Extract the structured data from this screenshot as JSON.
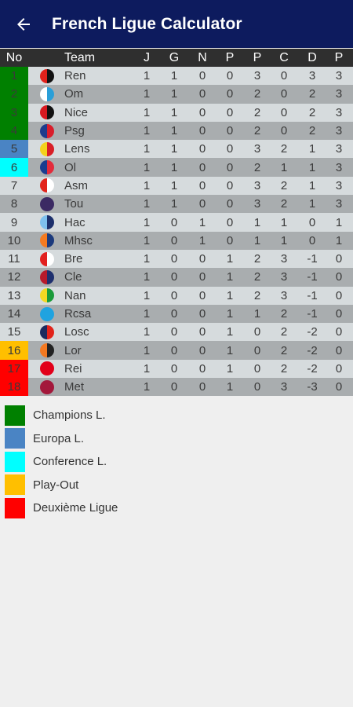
{
  "header": {
    "title": "French Ligue Calculator",
    "back_icon": "arrow-left-icon",
    "background": "#0d1b5e"
  },
  "table": {
    "columns": [
      "No",
      "Team",
      "J",
      "G",
      "N",
      "P",
      "P",
      "C",
      "D",
      "P"
    ],
    "rows": [
      {
        "no": "1",
        "team": "Ren",
        "j": "1",
        "g": "1",
        "n": "0",
        "l": "0",
        "gf": "3",
        "ga": "0",
        "d": "3",
        "pts": "3",
        "zone": "#008000",
        "logo": [
          "#e0211b",
          "#111111"
        ]
      },
      {
        "no": "2",
        "team": "Om",
        "j": "1",
        "g": "1",
        "n": "0",
        "l": "0",
        "gf": "2",
        "ga": "0",
        "d": "2",
        "pts": "3",
        "zone": "#008000",
        "logo": [
          "#ffffff",
          "#2a9fd8"
        ]
      },
      {
        "no": "3",
        "team": "Nice",
        "j": "1",
        "g": "1",
        "n": "0",
        "l": "0",
        "gf": "2",
        "ga": "0",
        "d": "2",
        "pts": "3",
        "zone": "#008000",
        "logo": [
          "#d71920",
          "#111111"
        ]
      },
      {
        "no": "4",
        "team": "Psg",
        "j": "1",
        "g": "1",
        "n": "0",
        "l": "0",
        "gf": "2",
        "ga": "0",
        "d": "2",
        "pts": "3",
        "zone": "#008000",
        "logo": [
          "#1e3c8c",
          "#d91e2b"
        ]
      },
      {
        "no": "5",
        "team": "Lens",
        "j": "1",
        "g": "1",
        "n": "0",
        "l": "0",
        "gf": "3",
        "ga": "2",
        "d": "1",
        "pts": "3",
        "zone": "#4a84c4",
        "logo": [
          "#f4d11b",
          "#d81f27"
        ]
      },
      {
        "no": "6",
        "team": "Ol",
        "j": "1",
        "g": "1",
        "n": "0",
        "l": "0",
        "gf": "2",
        "ga": "1",
        "d": "1",
        "pts": "3",
        "zone": "#00ffff",
        "logo": [
          "#1b3d8f",
          "#e32b3b"
        ]
      },
      {
        "no": "7",
        "team": "Asm",
        "j": "1",
        "g": "1",
        "n": "0",
        "l": "0",
        "gf": "3",
        "ga": "2",
        "d": "1",
        "pts": "3",
        "zone": "",
        "logo": [
          "#e2231a",
          "#ffffff"
        ]
      },
      {
        "no": "8",
        "team": "Tou",
        "j": "1",
        "g": "1",
        "n": "0",
        "l": "0",
        "gf": "3",
        "ga": "2",
        "d": "1",
        "pts": "3",
        "zone": "",
        "logo": [
          "#3b2a63",
          "#3b2a63"
        ]
      },
      {
        "no": "9",
        "team": "Hac",
        "j": "1",
        "g": "0",
        "n": "1",
        "l": "0",
        "gf": "1",
        "ga": "1",
        "d": "0",
        "pts": "1",
        "zone": "",
        "logo": [
          "#7ec0ee",
          "#1c2f6b"
        ]
      },
      {
        "no": "10",
        "team": "Mhsc",
        "j": "1",
        "g": "0",
        "n": "1",
        "l": "0",
        "gf": "1",
        "ga": "1",
        "d": "0",
        "pts": "1",
        "zone": "",
        "logo": [
          "#f47a20",
          "#1c3a7c"
        ]
      },
      {
        "no": "11",
        "team": "Bre",
        "j": "1",
        "g": "0",
        "n": "0",
        "l": "1",
        "gf": "2",
        "ga": "3",
        "d": "-1",
        "pts": "0",
        "zone": "",
        "logo": [
          "#e2201f",
          "#ffffff"
        ]
      },
      {
        "no": "12",
        "team": "Cle",
        "j": "1",
        "g": "0",
        "n": "0",
        "l": "1",
        "gf": "2",
        "ga": "3",
        "d": "-1",
        "pts": "0",
        "zone": "",
        "logo": [
          "#b71a2c",
          "#1e2f6e"
        ]
      },
      {
        "no": "13",
        "team": "Nan",
        "j": "1",
        "g": "0",
        "n": "0",
        "l": "1",
        "gf": "2",
        "ga": "3",
        "d": "-1",
        "pts": "0",
        "zone": "",
        "logo": [
          "#f3d923",
          "#1b9b3a"
        ]
      },
      {
        "no": "14",
        "team": "Rcsa",
        "j": "1",
        "g": "0",
        "n": "0",
        "l": "1",
        "gf": "1",
        "ga": "2",
        "d": "-1",
        "pts": "0",
        "zone": "",
        "logo": [
          "#1fa3e0",
          "#1fa3e0"
        ]
      },
      {
        "no": "15",
        "team": "Losc",
        "j": "1",
        "g": "0",
        "n": "0",
        "l": "1",
        "gf": "0",
        "ga": "2",
        "d": "-2",
        "pts": "0",
        "zone": "",
        "logo": [
          "#1c2a5e",
          "#e2231a"
        ]
      },
      {
        "no": "16",
        "team": "Lor",
        "j": "1",
        "g": "0",
        "n": "0",
        "l": "1",
        "gf": "0",
        "ga": "2",
        "d": "-2",
        "pts": "0",
        "zone": "#ffbf00",
        "logo": [
          "#f47920",
          "#222222"
        ]
      },
      {
        "no": "17",
        "team": "Rei",
        "j": "1",
        "g": "0",
        "n": "0",
        "l": "1",
        "gf": "0",
        "ga": "2",
        "d": "-2",
        "pts": "0",
        "zone": "#ff0000",
        "logo": [
          "#e2001a",
          "#e2001a"
        ]
      },
      {
        "no": "18",
        "team": "Met",
        "j": "1",
        "g": "0",
        "n": "0",
        "l": "1",
        "gf": "0",
        "ga": "3",
        "d": "-3",
        "pts": "0",
        "zone": "#ff0000",
        "logo": [
          "#a3183b",
          "#a3183b"
        ]
      }
    ],
    "row_colors": {
      "odd": "#d6dbdd",
      "even": "#a9adaf",
      "header": "#2f2f2f"
    }
  },
  "legend": [
    {
      "label": "Champions L.",
      "color": "#008000"
    },
    {
      "label": "Europa L.",
      "color": "#4a84c4"
    },
    {
      "label": "Conference L.",
      "color": "#00ffff"
    },
    {
      "label": "Play-Out",
      "color": "#ffbf00"
    },
    {
      "label": "Deuxième Ligue",
      "color": "#ff0000"
    }
  ]
}
